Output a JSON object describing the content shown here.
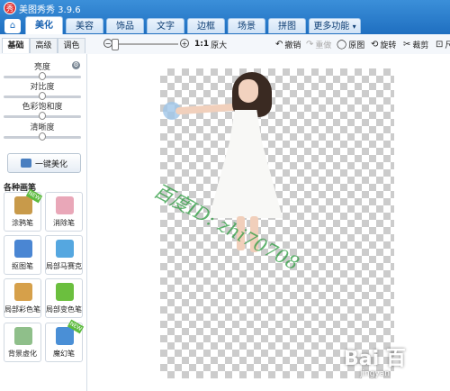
{
  "app": {
    "title": "美图秀秀 3.9.6",
    "logo": "秀"
  },
  "tabs": [
    {
      "label": "美化",
      "active": true
    },
    {
      "label": "美容"
    },
    {
      "label": "饰品"
    },
    {
      "label": "文字"
    },
    {
      "label": "边框"
    },
    {
      "label": "场景"
    },
    {
      "label": "拼图"
    },
    {
      "label": "更多功能",
      "caret": "▾"
    }
  ],
  "home_icon": "⌂",
  "subtabs": [
    "基础",
    "高级",
    "调色"
  ],
  "zoom": {
    "minus": "−",
    "plus": "+",
    "one_to_one": "1:1",
    "original": "原大"
  },
  "tools": [
    {
      "icon": "↶",
      "label": "撤销"
    },
    {
      "icon": "↷",
      "label": "重做"
    },
    {
      "icon": "◯",
      "label": "原图"
    },
    {
      "icon": "⟲",
      "label": "旋转"
    },
    {
      "icon": "✂",
      "label": "裁剪"
    },
    {
      "icon": "⊡",
      "label": "尺"
    }
  ],
  "adjust": [
    {
      "label": "亮度",
      "level": 0.5
    },
    {
      "label": "对比度",
      "level": 0.5
    },
    {
      "label": "色彩饱和度",
      "level": 0.5
    },
    {
      "label": "清晰度",
      "level": 0.5
    }
  ],
  "settings_icon": "⚙",
  "onekey": "一键美化",
  "brush_section": "各种画笔",
  "brushes": [
    {
      "label": "涂鸦笔",
      "icon": "pen-icon",
      "color": "#c89a4a",
      "badge": "NEW"
    },
    {
      "label": "消除笔",
      "icon": "eraser-icon",
      "color": "#e9a7b8"
    },
    {
      "label": "抠图笔",
      "icon": "cutout-icon",
      "color": "#4a86d3"
    },
    {
      "label": "局部马赛克",
      "icon": "mosaic-icon",
      "color": "#55a7e0"
    },
    {
      "label": "局部彩色笔",
      "icon": "color-brush-icon",
      "color": "#d6a04a"
    },
    {
      "label": "局部变色笔",
      "icon": "color-bucket-icon",
      "color": "#6bbf3e"
    },
    {
      "label": "背景虚化",
      "icon": "blur-icon",
      "color": "#8fbf8a"
    },
    {
      "label": "魔幻笔",
      "icon": "magic-pen-icon",
      "color": "#4a8fd6",
      "badge": "NEW"
    }
  ],
  "watermark": "百度ID: zhi70708",
  "baidu": {
    "logo": "Bai 百",
    "sub": "jingyan"
  }
}
